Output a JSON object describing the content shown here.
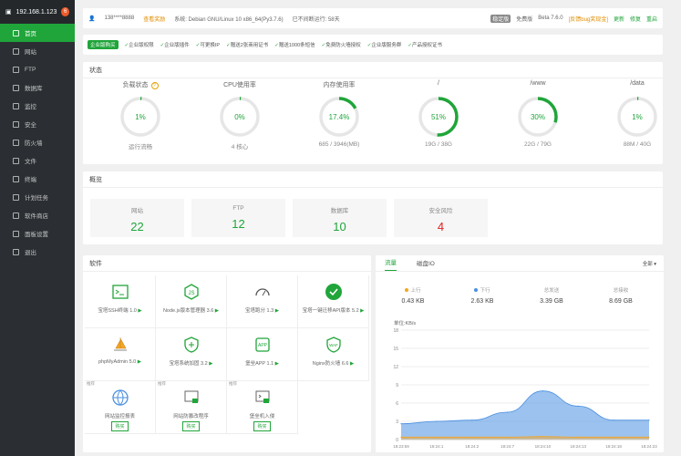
{
  "sidebar": {
    "host": "192.168.1.123",
    "badge": "6",
    "items": [
      {
        "label": "首页",
        "icon": "home-icon",
        "active": true
      },
      {
        "label": "网站",
        "icon": "globe-icon"
      },
      {
        "label": "FTP",
        "icon": "ftp-icon"
      },
      {
        "label": "数据库",
        "icon": "database-icon"
      },
      {
        "label": "监控",
        "icon": "monitor-icon"
      },
      {
        "label": "安全",
        "icon": "shield-icon"
      },
      {
        "label": "防火墙",
        "icon": "firewall-icon"
      },
      {
        "label": "文件",
        "icon": "folder-icon"
      },
      {
        "label": "终端",
        "icon": "terminal-icon"
      },
      {
        "label": "计划任务",
        "icon": "clock-icon"
      },
      {
        "label": "软件商店",
        "icon": "store-icon"
      },
      {
        "label": "面板设置",
        "icon": "gear-icon"
      },
      {
        "label": "退出",
        "icon": "logout-icon"
      }
    ]
  },
  "topbar": {
    "user": "138****8888",
    "bind": "查看奖励",
    "system": "系统: Debian GNU/Linux 10 x86_64(Py3.7.6)",
    "uptime": "已不间断运行: 58天",
    "version_tag": "稳定版",
    "pro": "免费版",
    "version": "Beta 7.6.0",
    "feedback": "[反馈bug奖现金]",
    "update": "更新",
    "repair": "修复",
    "restart": "重启"
  },
  "features": {
    "tag": "企业版购买",
    "items": [
      "企业版权限",
      "企业版插件",
      "可更换IP",
      "赠送2张商用证书",
      "赠送1000条短信",
      "免费防火墙授权",
      "企业版服务群",
      "产品授权证书"
    ]
  },
  "status": {
    "title": "状态",
    "gauges": [
      {
        "label": "负载状态",
        "value": "1%",
        "pct": 1,
        "sub": "运行流畅",
        "help": "?"
      },
      {
        "label": "CPU使用率",
        "value": "0%",
        "pct": 0,
        "sub": "4 核心"
      },
      {
        "label": "内存使用率",
        "value": "17.4%",
        "pct": 17.4,
        "sub": "685 / 3946(MB)"
      },
      {
        "label": "/",
        "value": "51%",
        "pct": 51,
        "sub": "19G / 38G"
      },
      {
        "label": "/www",
        "value": "30%",
        "pct": 30,
        "sub": "22G / 79G"
      },
      {
        "label": "/data",
        "value": "1%",
        "pct": 1,
        "sub": "88M / 40G"
      }
    ]
  },
  "overview": {
    "title": "概览",
    "cards": [
      {
        "label": "网站",
        "value": "22"
      },
      {
        "label": "FTP",
        "value": "12"
      },
      {
        "label": "数据库",
        "value": "10"
      },
      {
        "label": "安全风险",
        "value": "4",
        "danger": true
      }
    ]
  },
  "software": {
    "title": "软件",
    "items": [
      {
        "name": "宝塔SSH终端 1.0",
        "icon": "terminal-icon"
      },
      {
        "name": "Node.js版本管理器 3.6",
        "icon": "nodejs-icon"
      },
      {
        "name": "宝塔跑分 1.3",
        "icon": "speedometer-icon"
      },
      {
        "name": "宝塔一键迁移API版本 5.2",
        "icon": "check-circle-icon"
      },
      {
        "name": "phpMyAdmin 5.0",
        "icon": "sailboat-icon"
      },
      {
        "name": "宝塔系统加固 3.2",
        "icon": "shield-plus-icon"
      },
      {
        "name": "堡垒APP 1.1",
        "icon": "app-icon"
      },
      {
        "name": "Nginx防火墙 6.6",
        "icon": "waf-icon"
      },
      {
        "name": "网站监控报表",
        "icon": "globe-icon",
        "small": "推荐",
        "button": "购买"
      },
      {
        "name": "网站防篡改程序",
        "icon": "lock-icon",
        "small": "推荐",
        "button": "购买"
      },
      {
        "name": "堡垒机入侵",
        "icon": "terminal-lock-icon",
        "small": "推荐",
        "button": "购买"
      }
    ]
  },
  "traffic": {
    "tabs": [
      "流量",
      "磁盘IO"
    ],
    "select": "全部",
    "stats": [
      {
        "label": "上行",
        "value": "0.43 KB",
        "color": "#f5a623"
      },
      {
        "label": "下行",
        "value": "2.63 KB",
        "color": "#4a90e2"
      },
      {
        "label": "总发送",
        "value": "3.39 GB"
      },
      {
        "label": "总接收",
        "value": "8.69 GB"
      }
    ]
  },
  "chart_data": {
    "type": "area",
    "ylabel": "单位:KB/s",
    "ylim": [
      0,
      18
    ],
    "yticks": [
      0,
      3,
      6,
      9,
      12,
      15,
      18
    ],
    "categories": [
      "18:23:59",
      "18:24:1",
      "18:24:2",
      "18:24:7",
      "18:24:10",
      "18:24:13",
      "18:24:18",
      "18:24:23"
    ],
    "series": [
      {
        "name": "下行",
        "color": "#4a90e2",
        "values": [
          2.6,
          3.0,
          3.2,
          4.5,
          8.0,
          5.5,
          3.2,
          3.2
        ]
      },
      {
        "name": "上行",
        "color": "#f5a623",
        "values": [
          0.4,
          0.4,
          0.4,
          0.4,
          0.5,
          0.4,
          0.4,
          0.4
        ]
      }
    ]
  }
}
